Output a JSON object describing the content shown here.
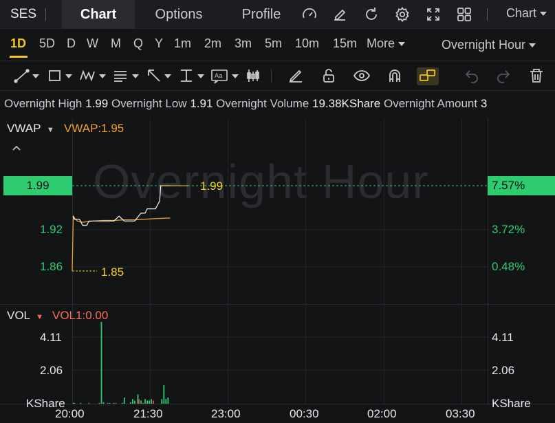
{
  "header": {
    "symbol": "SES",
    "tabs": [
      {
        "label": "Chart",
        "active": true
      },
      {
        "label": "Options",
        "active": false
      },
      {
        "label": "Profile",
        "active": false
      }
    ],
    "icons": [
      "gauge-icon",
      "edit-icon",
      "refresh-icon",
      "gear-icon",
      "fullscreen-icon",
      "grid-icon"
    ],
    "chart_menu": "Chart"
  },
  "periods": {
    "items": [
      "1D",
      "5D",
      "D",
      "W",
      "M",
      "Q",
      "Y",
      "1m",
      "2m",
      "3m",
      "5m",
      "10m",
      "15m",
      "More"
    ],
    "active": "1D",
    "session": "Overnight Hour"
  },
  "stats": {
    "high_label": "Overnight High",
    "high": "1.99",
    "low_label": "Overnight Low",
    "low": "1.91",
    "volume_label": "Overnight Volume",
    "volume": "19.38KShare",
    "amount_label": "Overnight Amount",
    "amount": "3"
  },
  "indicators": {
    "main_name": "VWAP",
    "main_value": "VWAP:1.95",
    "vol_name": "VOL",
    "vol_value": "VOL1:0.00"
  },
  "watermark": "Overnight Hour",
  "colors": {
    "up": "#2ecc71",
    "vwap": "#f0a030",
    "price_line": "#e8e8e8",
    "marker": "#f5d020",
    "vol_label": "#ff6b5b"
  },
  "chart_data": [
    {
      "type": "line",
      "left_ticks": [
        "1.99",
        "1.92",
        "1.86"
      ],
      "right_ticks": [
        "7.57%",
        "3.72%",
        "0.48%"
      ],
      "current_price": "1.99",
      "current_change": "7.57%",
      "high_marker": "1.99",
      "low_marker": "1.85",
      "ylim": [
        1.848,
        2.0
      ],
      "x_ticks": [
        "20:00",
        "21:30",
        "23:00",
        "00:30",
        "02:00",
        "03:30"
      ],
      "series": [
        {
          "name": "VWAP",
          "x": [
            0,
            1,
            3,
            5,
            10,
            20,
            30,
            40,
            50,
            60,
            70,
            80,
            94
          ],
          "y": [
            1.85,
            1.94,
            1.935,
            1.932,
            1.93,
            1.932,
            1.933,
            1.933,
            1.934,
            1.934,
            1.935,
            1.936,
            1.937
          ]
        },
        {
          "name": "",
          "x": [
            1,
            2,
            7,
            10,
            14,
            16,
            20,
            30,
            40,
            45,
            50,
            60,
            66,
            70,
            72,
            74,
            80,
            84,
            85,
            94
          ],
          "y": [
            1.94,
            1.935,
            1.935,
            1.925,
            1.925,
            1.932,
            1.932,
            1.932,
            1.932,
            1.94,
            1.932,
            1.932,
            1.945,
            1.945,
            1.952,
            1.952,
            1.952,
            1.965,
            1.99,
            1.99
          ]
        }
      ]
    },
    {
      "type": "bar",
      "name": "VOL",
      "unit": "KShare",
      "ticks": [
        "4.11",
        "2.06"
      ],
      "ylim": [
        0,
        5.3
      ],
      "x": [
        1,
        2,
        8,
        16,
        26,
        28,
        30,
        34,
        36,
        40,
        42,
        48,
        50,
        56,
        58,
        60,
        63,
        64,
        66,
        68,
        70,
        72,
        74,
        76,
        78,
        86,
        88,
        90,
        92
      ],
      "values": [
        0.05,
        0.05,
        0.05,
        0.05,
        0.05,
        5.3,
        0.1,
        0.05,
        0.05,
        0.05,
        0.05,
        0.05,
        0.4,
        0.1,
        0.3,
        0.2,
        0.6,
        0.3,
        0.2,
        0.05,
        0.3,
        0.2,
        0.2,
        0.3,
        0.2,
        0.3,
        1.2,
        0.3,
        0.4
      ]
    }
  ]
}
